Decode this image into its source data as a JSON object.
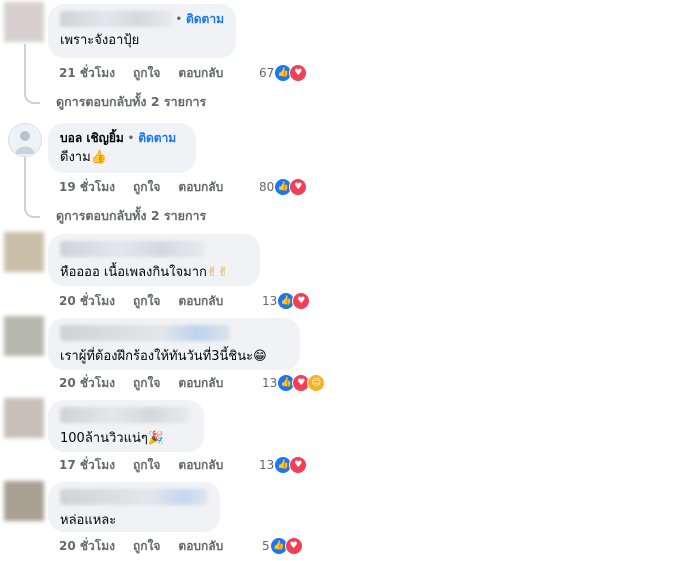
{
  "follow_label": "ติดตาม",
  "like_label": "ถูกใจ",
  "reply_label": "ตอบกลับ",
  "comments": [
    {
      "name": "",
      "name_blurred": true,
      "show_follow": true,
      "text": "เพราะจังอาปุ้ย",
      "emoji": "",
      "time": "21 ชั่วโมง",
      "reaction_count": "67",
      "reactions": [
        "like",
        "love"
      ],
      "view_replies": "ดูการตอบกลับทั้ง 2 รายการ"
    },
    {
      "name": "บอล เชิญยิ้ม",
      "name_blurred": false,
      "show_follow": true,
      "text": "ดีงาม",
      "emoji": "👍",
      "time": "19 ชั่วโมง",
      "reaction_count": "80",
      "reactions": [
        "like",
        "love"
      ],
      "view_replies": "ดูการตอบกลับทั้ง 2 รายการ"
    },
    {
      "name": "",
      "name_blurred": true,
      "show_follow": false,
      "text": "หืออออ เนื้อเพลงกินใจมาก",
      "emoji": "✌✌",
      "time": "20 ชั่วโมง",
      "reaction_count": "13",
      "reactions": [
        "like",
        "love"
      ]
    },
    {
      "name": "",
      "name_blurred": true,
      "show_follow": false,
      "text": "เราผู้ที่ต้องฝึกร้องให้ทันวันที่3นี้ชินะ",
      "emoji": "😁",
      "time": "20 ชั่วโมง",
      "reaction_count": "13",
      "reactions": [
        "like",
        "love",
        "care"
      ]
    },
    {
      "name": "",
      "name_blurred": true,
      "show_follow": false,
      "text": "100ล้านวิวแน่ๆ",
      "emoji": "🎉",
      "time": "17 ชั่วโมง",
      "reaction_count": "13",
      "reactions": [
        "like",
        "love"
      ]
    },
    {
      "name": "",
      "name_blurred": true,
      "show_follow": false,
      "text": "หล่อแหละ",
      "emoji": "",
      "time": "20 ชั่วโมง",
      "reaction_count": "5",
      "reactions": [
        "like",
        "love"
      ]
    }
  ]
}
